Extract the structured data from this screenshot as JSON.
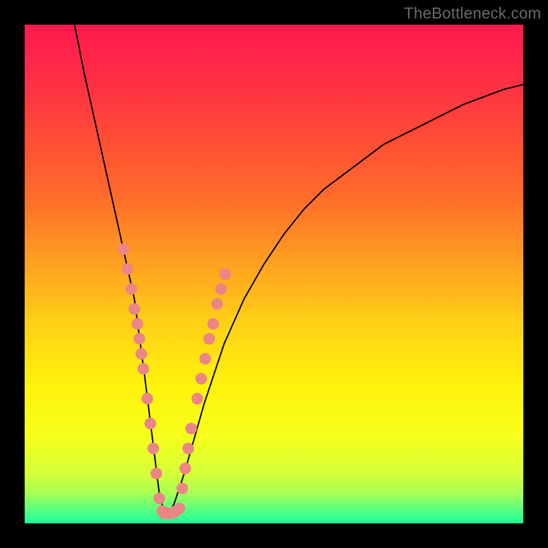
{
  "watermark": "TheBottleneck.com",
  "colors": {
    "frame": "#000000",
    "curve": "#000000",
    "dot": "#ec8585",
    "gradient_stops": [
      {
        "offset": 0.0,
        "color": "#ff1a4e"
      },
      {
        "offset": 0.1,
        "color": "#ff2c47"
      },
      {
        "offset": 0.22,
        "color": "#ff4a36"
      },
      {
        "offset": 0.35,
        "color": "#ff6d2a"
      },
      {
        "offset": 0.48,
        "color": "#ffa11f"
      },
      {
        "offset": 0.6,
        "color": "#ffd116"
      },
      {
        "offset": 0.72,
        "color": "#fff20c"
      },
      {
        "offset": 0.82,
        "color": "#f8ff1a"
      },
      {
        "offset": 0.9,
        "color": "#d6ff38"
      },
      {
        "offset": 0.94,
        "color": "#a8ff55"
      },
      {
        "offset": 0.97,
        "color": "#5fff7d"
      },
      {
        "offset": 1.0,
        "color": "#1aff9a"
      }
    ]
  },
  "chart_data": {
    "type": "line",
    "title": "",
    "xlabel": "",
    "ylabel": "",
    "xlim": [
      0,
      100
    ],
    "ylim": [
      0,
      100
    ],
    "series": [
      {
        "name": "bottleneck-curve",
        "x": [
          10,
          12,
          14,
          16,
          18,
          20,
          22,
          24,
          25,
          26,
          27,
          28,
          29,
          30,
          32,
          34,
          36,
          38,
          40,
          44,
          48,
          52,
          56,
          60,
          64,
          68,
          72,
          76,
          80,
          84,
          88,
          92,
          96,
          100
        ],
        "y": [
          100,
          90,
          81,
          72,
          63,
          54,
          45,
          30,
          22,
          14,
          6,
          2,
          2,
          4,
          10,
          17,
          24,
          30,
          36,
          45,
          52,
          58,
          63,
          67,
          70,
          73,
          76,
          78,
          80,
          82,
          84,
          85.5,
          87,
          88
        ]
      }
    ],
    "scatter": [
      {
        "name": "left-branch-dots",
        "points": [
          [
            19.8,
            55
          ],
          [
            20.6,
            51
          ],
          [
            21.4,
            47
          ],
          [
            22.0,
            43
          ],
          [
            22.6,
            40
          ],
          [
            23.0,
            37
          ],
          [
            23.4,
            34
          ],
          [
            23.8,
            31
          ],
          [
            24.6,
            25
          ],
          [
            25.2,
            20
          ],
          [
            25.8,
            15
          ],
          [
            26.4,
            10
          ],
          [
            27.0,
            5
          ],
          [
            27.6,
            2.5
          ]
        ]
      },
      {
        "name": "valley-dots",
        "points": [
          [
            28.0,
            2
          ],
          [
            28.6,
            2
          ],
          [
            29.2,
            2
          ],
          [
            29.8,
            2.2
          ],
          [
            30.4,
            2.5
          ],
          [
            31.0,
            3
          ]
        ]
      },
      {
        "name": "right-branch-dots",
        "points": [
          [
            31.6,
            7
          ],
          [
            32.2,
            11
          ],
          [
            32.8,
            15
          ],
          [
            33.4,
            19
          ],
          [
            34.6,
            25
          ],
          [
            35.4,
            29
          ],
          [
            36.2,
            33
          ],
          [
            37.0,
            37
          ],
          [
            37.8,
            40
          ],
          [
            38.6,
            44
          ],
          [
            39.4,
            47
          ],
          [
            40.2,
            50
          ]
        ]
      }
    ]
  }
}
